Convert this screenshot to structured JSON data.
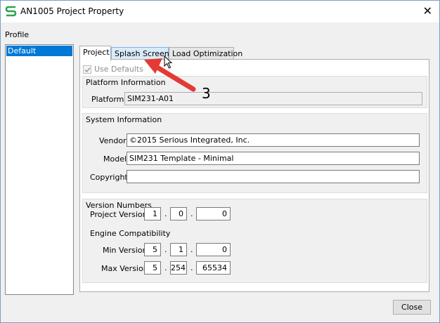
{
  "window": {
    "title": "AN1005 Project Property"
  },
  "profile": {
    "label": "Profile",
    "items": [
      "Default"
    ]
  },
  "tabs": [
    {
      "label": "Project"
    },
    {
      "label": "Splash Screens"
    },
    {
      "label": "Load Optimization"
    }
  ],
  "use_defaults": {
    "label": "Use Defaults",
    "checked": true
  },
  "platform_info": {
    "title": "Platform Information",
    "platform_label": "Platform",
    "platform_value": "SIM231-A01"
  },
  "system_info": {
    "title": "System Information",
    "vendor_label": "Vendor",
    "vendor_value": "©2015 Serious Integrated, Inc.",
    "model_label": "Model",
    "model_value": "SIM231 Template - Minimal",
    "copyright_label": "Copyright",
    "copyright_value": ""
  },
  "version_numbers": {
    "title": "Version Numbers",
    "project_version_label": "Project Version",
    "project_version": [
      "1",
      "0",
      "0"
    ],
    "engine_label": "Engine Compatibility",
    "min_version_label": "Min Version",
    "min_version": [
      "5",
      "1",
      "0"
    ],
    "max_version_label": "Max Version",
    "max_version": [
      "5",
      "254",
      "65534"
    ],
    "separator": "."
  },
  "close_button": "Close",
  "annotation": {
    "number": "3",
    "color": "#e53935"
  },
  "colors": {
    "selection": "#0078d7",
    "accent": "#2da44e"
  }
}
